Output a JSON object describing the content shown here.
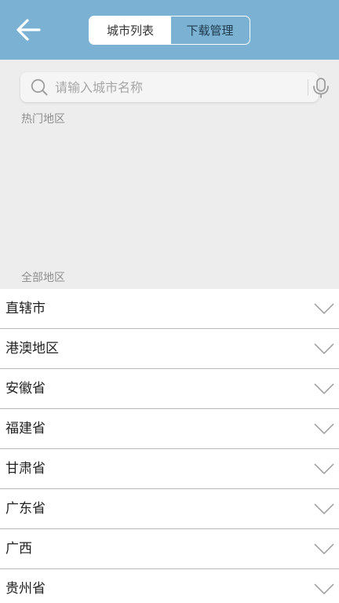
{
  "header": {
    "back_icon": "arrow-left-icon",
    "tabs": [
      {
        "label": "城市列表",
        "active": true
      },
      {
        "label": "下载管理",
        "active": false
      }
    ],
    "background_color": "#7bb1d2"
  },
  "search": {
    "placeholder": "请输入城市名称",
    "value": "",
    "search_icon": "search-icon",
    "mic_icon": "microphone-icon"
  },
  "sections": {
    "hot_label": "热门地区",
    "all_label": "全部地区"
  },
  "regions": [
    {
      "label": "直辖市"
    },
    {
      "label": "港澳地区"
    },
    {
      "label": "安徽省"
    },
    {
      "label": "福建省"
    },
    {
      "label": "甘肃省"
    },
    {
      "label": "广东省"
    },
    {
      "label": "广西"
    },
    {
      "label": "贵州省"
    }
  ]
}
